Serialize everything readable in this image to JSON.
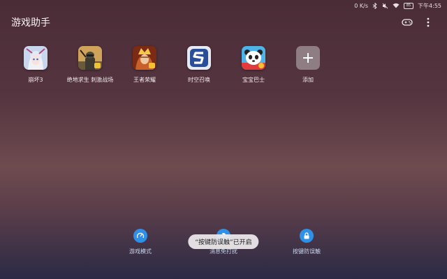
{
  "status_bar": {
    "network_speed": "0 K/s",
    "battery_level": "85",
    "time": "下午4:55"
  },
  "header": {
    "title": "游戏助手"
  },
  "games": [
    {
      "label": "崩坏3",
      "icon": "honkai-impact-3-icon"
    },
    {
      "label": "绝地求生 刺激战场",
      "icon": "pubg-mobile-icon"
    },
    {
      "label": "王者荣耀",
      "icon": "honor-of-kings-icon"
    },
    {
      "label": "时空召唤",
      "icon": "time-space-summon-icon"
    },
    {
      "label": "宝宝巴士",
      "icon": "babybus-panda-icon"
    },
    {
      "label": "添加",
      "icon": "plus-icon"
    }
  ],
  "bottom_actions": [
    {
      "label": "游戏模式",
      "icon": "speedometer-icon"
    },
    {
      "label": "消息免打扰",
      "icon": "bell-off-icon"
    },
    {
      "label": "按键防误触",
      "icon": "lock-icon"
    }
  ],
  "toast": {
    "text": "“按键防误触”已开启"
  },
  "colors": {
    "accent": "#2f90e8",
    "background_top": "#4a2c37",
    "background_bottom": "#2b2a45"
  }
}
